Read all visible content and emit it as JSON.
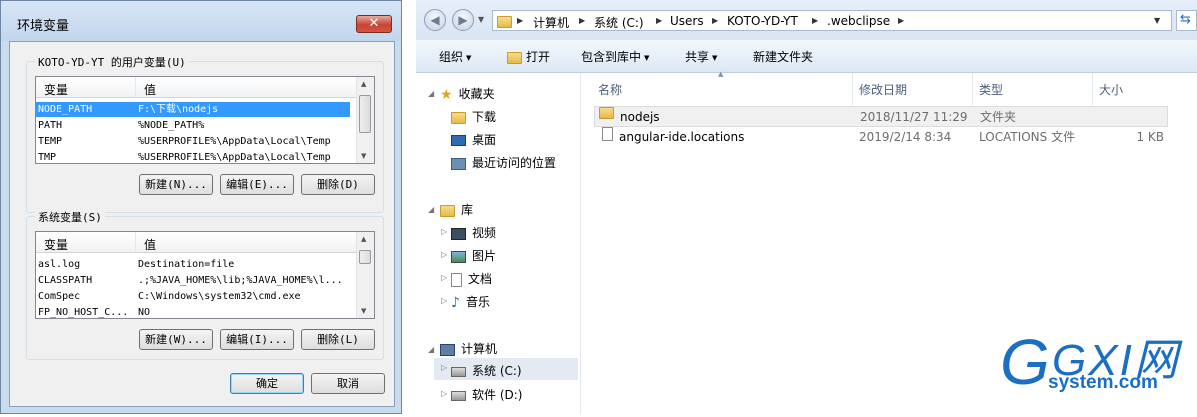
{
  "env_dialog": {
    "title": "环境变量",
    "close_glyph": "✕",
    "user_group_label": "KOTO-YD-YT 的用户变量(U)",
    "user_columns": [
      "变量",
      "值"
    ],
    "user_rows": [
      {
        "name": "NODE_PATH",
        "value": "F:\\下载\\nodejs",
        "selected": true
      },
      {
        "name": "PATH",
        "value": "%NODE_PATH%"
      },
      {
        "name": "TEMP",
        "value": "%USERPROFILE%\\AppData\\Local\\Temp"
      },
      {
        "name": "TMP",
        "value": "%USERPROFILE%\\AppData\\Local\\Temp"
      }
    ],
    "user_buttons": {
      "new": "新建(N)...",
      "edit": "编辑(E)...",
      "delete": "删除(D)"
    },
    "system_group_label": "系统变量(S)",
    "system_columns": [
      "变量",
      "值"
    ],
    "system_rows": [
      {
        "name": "asl.log",
        "value": "Destination=file"
      },
      {
        "name": "CLASSPATH",
        "value": ".;%JAVA_HOME%\\lib;%JAVA_HOME%\\l..."
      },
      {
        "name": "ComSpec",
        "value": "C:\\Windows\\system32\\cmd.exe"
      },
      {
        "name": "FP_NO_HOST_C...",
        "value": "NO"
      }
    ],
    "system_buttons": {
      "new": "新建(W)...",
      "edit": "编辑(I)...",
      "delete": "删除(L)"
    },
    "ok": "确定",
    "cancel": "取消"
  },
  "explorer": {
    "breadcrumb": [
      "计算机",
      "系统 (C:)",
      "Users",
      "KOTO-YD-YT",
      ".webclipse"
    ],
    "toolbar": {
      "organize": "组织",
      "open": "打开",
      "include": "包含到库中",
      "share": "共享",
      "new_folder": "新建文件夹"
    },
    "nav": {
      "favorites": "收藏夹",
      "downloads": "下载",
      "desktop": "桌面",
      "recent": "最近访问的位置",
      "libraries": "库",
      "videos": "视频",
      "pictures": "图片",
      "documents": "文档",
      "music": "音乐",
      "computer": "计算机",
      "drive_c": "系统 (C:)",
      "drive_d": "软件 (D:)"
    },
    "columns": {
      "name": "名称",
      "date": "修改日期",
      "type": "类型",
      "size": "大小"
    },
    "files": [
      {
        "name": "nodejs",
        "date": "2018/11/27 11:29",
        "type": "文件夹",
        "size": ""
      },
      {
        "name": "angular-ide.locations",
        "date": "2019/2/14 8:34",
        "type": "LOCATIONS 文件",
        "size": "1 KB"
      }
    ]
  },
  "watermark": {
    "logo": "GXI网",
    "site": "system.com"
  },
  "colors": {
    "selection": "#3399ff",
    "close_button": "#c64535",
    "watermark_blue": "#1a6fc4"
  }
}
